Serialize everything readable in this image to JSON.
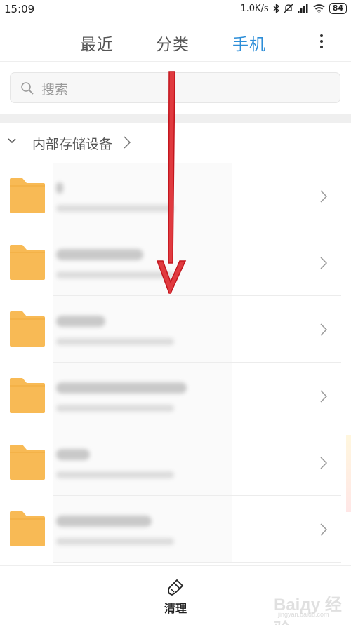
{
  "status_bar": {
    "time": "15:09",
    "network_speed": "1.0K/s",
    "battery": "84"
  },
  "tabs": [
    {
      "label": "最近",
      "active": false
    },
    {
      "label": "分类",
      "active": false
    },
    {
      "label": "手机",
      "active": true
    }
  ],
  "colors": {
    "accent": "#2d8ed8",
    "folder": "#f8ba55",
    "annotation_arrow": "#d8202a"
  },
  "search": {
    "placeholder": "搜索",
    "icon": "search-icon"
  },
  "storage": {
    "label": "内部存储设备",
    "expanded": true
  },
  "folders": [
    {
      "icon": "folder-icon"
    },
    {
      "icon": "folder-icon"
    },
    {
      "icon": "folder-icon"
    },
    {
      "icon": "folder-icon"
    },
    {
      "icon": "folder-icon"
    },
    {
      "icon": "folder-icon"
    }
  ],
  "bottom_bar": {
    "clean_label": "清理",
    "icon": "brush-icon"
  },
  "watermark": {
    "brand": "Baiду 经验",
    "url": "jingyan.baidu.com"
  }
}
